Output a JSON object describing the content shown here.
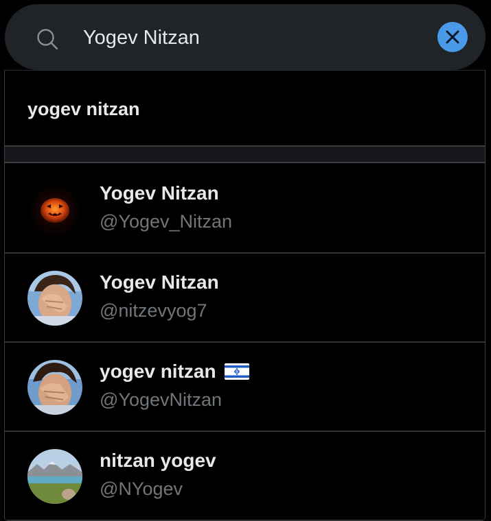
{
  "search": {
    "value": "Yogev Nitzan",
    "icon": "search-icon",
    "clear_icon": "close-icon",
    "accent_color": "#4a9ae9"
  },
  "query_suggestion": {
    "text": "yogev nitzan"
  },
  "users": [
    {
      "name": "Yogev Nitzan",
      "handle": "@Yogev_Nitzan",
      "avatar": "jack-o-lantern-avatar"
    },
    {
      "name": "Yogev Nitzan",
      "handle": "@nitzevyog7",
      "avatar": "photo-avatar-face"
    },
    {
      "name": "yogev nitzan",
      "handle": "@YogevNitzan",
      "avatar": "photo-avatar-face",
      "flag": "israel-flag-icon"
    },
    {
      "name": "nitzan yogev",
      "handle": "@NYogev",
      "avatar": "landscape-avatar"
    }
  ],
  "colors": {
    "background": "#000000",
    "search_bg": "#202327",
    "primary_text": "#e7e9ea",
    "secondary_text": "#71767b",
    "divider": "#2f3336"
  }
}
